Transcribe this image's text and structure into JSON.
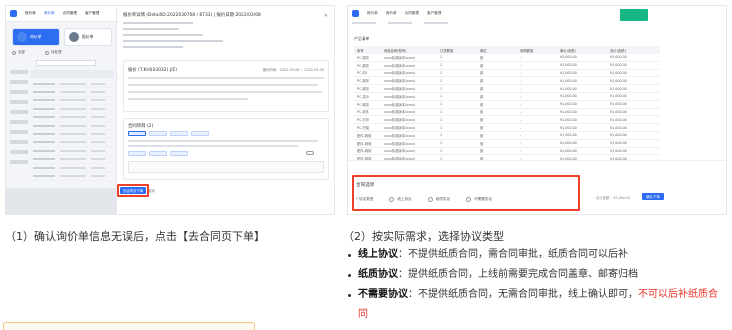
{
  "left_screenshot": {
    "top_nav": [
      "报价单",
      "询价单",
      "合同管理",
      "客户管理"
    ],
    "cards": [
      {
        "label": "询价单"
      },
      {
        "label": "报价单"
      }
    ],
    "radio_labels": [
      "全部",
      "待处理"
    ],
    "panel": {
      "header": "报价单详情 (DetailID:2022030708 / 8733) | 报价日期 2022/03/08",
      "section_quote": "报价 (T.KHI(03032) J/E)",
      "section_quote_right": "报价时间：2022-03-08 ~ 2022-03-30",
      "section_agreement": "合同项目 (2)",
      "contract_button": "去合同页下单",
      "cancel_button": "取消"
    }
  },
  "right_screenshot": {
    "caption": "产品清单",
    "columns": [
      "序号",
      "商品名称(型号)",
      "订货数量",
      "单位",
      "采购数量",
      "单价(含税)",
      "总价(含税)"
    ],
    "rows": [
      [
        "PC-服务",
        "xxxx标准版本(xxxx)",
        "1",
        "套",
        "-",
        "¥5,000.00",
        "¥5,000.00"
      ],
      [
        "PC-服务",
        "xxxx标准版本(xxxx)",
        "1",
        "套",
        "-",
        "¥3,000.00",
        "¥3,000.00"
      ],
      [
        "PC-机1",
        "xxxx标准版本(xxxx)",
        "1",
        "套",
        "-",
        "¥1,000.00",
        "¥1,000.00"
      ],
      [
        "PC-服务",
        "xxxx标准版本(xxxx)",
        "1",
        "套",
        "-",
        "¥1,000.00",
        "¥1,000.00"
      ],
      [
        "PC-服务",
        "xxxx标准版本(xxxx)",
        "1",
        "套",
        "-",
        "¥1,000.00",
        "¥1,000.00"
      ],
      [
        "PC-显示",
        "xxxx标准版本(xxxx)",
        "1",
        "套",
        "-",
        "¥1,000.00",
        "¥1,000.00"
      ],
      [
        "PC-服务",
        "xxxx标准版本(xxxx)",
        "1",
        "套",
        "-",
        "¥1,000.00",
        "¥1,000.00"
      ],
      [
        "PC-软件",
        "xxxx标准版本(xxxx)",
        "1",
        "套",
        "-",
        "¥1,000.00",
        "¥1,000.00"
      ],
      [
        "PC-打印",
        "xxxx标准版本(xxxx)",
        "1",
        "套",
        "-",
        "¥1,000.00",
        "¥1,000.00"
      ],
      [
        "PC-扫描",
        "xxxx标准版本(xxxx)",
        "1",
        "套",
        "-",
        "¥1,000.00",
        "¥1,000.00"
      ],
      [
        "配件-网络",
        "xxxx标准版本(xxxx)",
        "1",
        "套",
        "-",
        "¥1,000.00",
        "¥1,000.00"
      ],
      [
        "配件-网络",
        "xxxx标准版本(xxxx)",
        "1",
        "套",
        "-",
        "¥1,000.00",
        "¥1,000.00"
      ],
      [
        "配件-网络",
        "xxxx标准版本(xxxx)",
        "1",
        "套",
        "-",
        "¥1,000.00",
        "¥1,000.00"
      ],
      [
        "配件-网络",
        "xxxx标准版本(xxxx)",
        "1",
        "套",
        "-",
        "¥1,000.00",
        "¥1,000.00"
      ],
      [
        "配件-网络",
        "xxxx标准版本(xxxx)",
        "1",
        "套",
        "-",
        "¥1,000.00",
        "¥1,000.00"
      ]
    ],
    "options_title": "合同选项",
    "options": [
      "* 协议类型",
      "线上协议",
      "纸质协议",
      "不需要协议"
    ],
    "submit_note": "合计金额： ¥5,000.00",
    "submit": "确认下单"
  },
  "captions": {
    "step1": "（1）确认询价单信息无误后，点击【去合同页下单】",
    "step2": "（2）按实际需求，选择协议类型"
  },
  "bullets": [
    {
      "term": "线上协议",
      "text": "：不提供纸质合同，需合同审批，纸质合同可以后补",
      "warn": ""
    },
    {
      "term": "纸质协议",
      "text": "：提供纸质合同，上线前需要完成合同盖章、邮寄归档",
      "warn": ""
    },
    {
      "term": "不需要协议",
      "text": "：不提供纸质合同，无需合同审批，线上确认即可，",
      "warn": "不可以后补纸质合同"
    }
  ],
  "colors": {
    "accent": "#2c6df2",
    "highlight_box": "#ee3f2b",
    "warning_text": "#e8352a",
    "brand_green": "#19b685"
  }
}
